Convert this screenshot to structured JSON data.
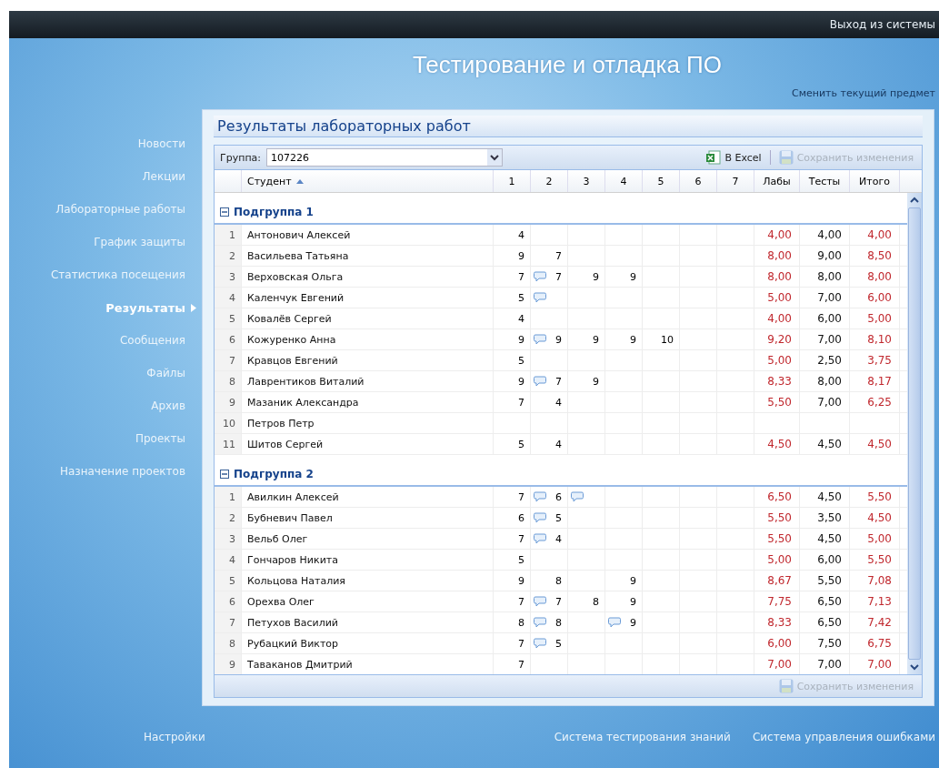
{
  "top_bar": {
    "logout_link": "Выход из системы"
  },
  "header": {
    "title": "Тестирование и отладка ПО",
    "change_subject_link": "Сменить текущий предмет"
  },
  "sidebar": {
    "items": [
      {
        "label": "Новости",
        "selected": false
      },
      {
        "label": "Лекции",
        "selected": false
      },
      {
        "label": "Лабораторные работы",
        "selected": false
      },
      {
        "label": "График защиты",
        "selected": false
      },
      {
        "label": "Статистика посещения",
        "selected": false
      },
      {
        "label": "Результаты",
        "selected": true
      },
      {
        "label": "Сообщения",
        "selected": false
      },
      {
        "label": "Файлы",
        "selected": false
      },
      {
        "label": "Архив",
        "selected": false
      },
      {
        "label": "Проекты",
        "selected": false
      },
      {
        "label": "Назначение проектов",
        "selected": false
      }
    ]
  },
  "panel": {
    "title": "Результаты лабораторных работ"
  },
  "toolbar": {
    "group_label": "Группа:",
    "group_value": "107226",
    "excel_button": "В Excel",
    "save_button": {
      "label": "Сохранить изменения",
      "disabled": true
    }
  },
  "grid": {
    "columns": [
      {
        "label": "Студент",
        "sorted_ascending": true
      },
      {
        "label": "1",
        "sorted_ascending": false
      },
      {
        "label": "2",
        "sorted_ascending": false
      },
      {
        "label": "3",
        "sorted_ascending": false
      },
      {
        "label": "4",
        "sorted_ascending": false
      },
      {
        "label": "5",
        "sorted_ascending": false
      },
      {
        "label": "6",
        "sorted_ascending": false
      },
      {
        "label": "7",
        "sorted_ascending": false
      },
      {
        "label": "Лабы",
        "sorted_ascending": false
      },
      {
        "label": "Тесты",
        "sorted_ascending": false
      },
      {
        "label": "Итого",
        "sorted_ascending": false
      }
    ],
    "groups": [
      {
        "title": "Подгруппа 1",
        "expanded": true,
        "rows": [
          {
            "number": "1",
            "name": "Антонович Алексей",
            "marks": [
              {
                "value": "4",
                "comment": false
              },
              {
                "comment": false
              },
              {
                "comment": false
              },
              {
                "comment": false
              },
              {
                "comment": false
              },
              {
                "comment": false
              },
              {
                "comment": false
              }
            ],
            "labs": "4,00",
            "tests": "4,00",
            "total": "4,00"
          },
          {
            "number": "2",
            "name": "Васильева Татьяна",
            "marks": [
              {
                "value": "9",
                "comment": false
              },
              {
                "value": "7",
                "comment": false
              },
              {
                "comment": false
              },
              {
                "comment": false
              },
              {
                "comment": false
              },
              {
                "comment": false
              },
              {
                "comment": false
              }
            ],
            "labs": "8,00",
            "tests": "9,00",
            "total": "8,50"
          },
          {
            "number": "3",
            "name": "Верховская Ольга",
            "marks": [
              {
                "value": "7",
                "comment": false
              },
              {
                "value": "7",
                "comment": true
              },
              {
                "value": "9",
                "comment": false
              },
              {
                "value": "9",
                "comment": false
              },
              {
                "comment": false
              },
              {
                "comment": false
              },
              {
                "comment": false
              }
            ],
            "labs": "8,00",
            "tests": "8,00",
            "total": "8,00"
          },
          {
            "number": "4",
            "name": "Каленчук Евгений",
            "marks": [
              {
                "value": "5",
                "comment": false
              },
              {
                "comment": true
              },
              {
                "comment": false
              },
              {
                "comment": false
              },
              {
                "comment": false
              },
              {
                "comment": false
              },
              {
                "comment": false
              }
            ],
            "labs": "5,00",
            "tests": "7,00",
            "total": "6,00"
          },
          {
            "number": "5",
            "name": "Ковалёв Сергей",
            "marks": [
              {
                "value": "4",
                "comment": false
              },
              {
                "comment": false
              },
              {
                "comment": false
              },
              {
                "comment": false
              },
              {
                "comment": false
              },
              {
                "comment": false
              },
              {
                "comment": false
              }
            ],
            "labs": "4,00",
            "tests": "6,00",
            "total": "5,00"
          },
          {
            "number": "6",
            "name": "Кожуренко Анна",
            "marks": [
              {
                "value": "9",
                "comment": false
              },
              {
                "value": "9",
                "comment": true
              },
              {
                "value": "9",
                "comment": false
              },
              {
                "value": "9",
                "comment": false
              },
              {
                "value": "10",
                "comment": false
              },
              {
                "comment": false
              },
              {
                "comment": false
              }
            ],
            "labs": "9,20",
            "tests": "7,00",
            "total": "8,10"
          },
          {
            "number": "7",
            "name": "Кравцов Евгений",
            "marks": [
              {
                "value": "5",
                "comment": false
              },
              {
                "comment": false
              },
              {
                "comment": false
              },
              {
                "comment": false
              },
              {
                "comment": false
              },
              {
                "comment": false
              },
              {
                "comment": false
              }
            ],
            "labs": "5,00",
            "tests": "2,50",
            "total": "3,75"
          },
          {
            "number": "8",
            "name": "Лаврентиков Виталий",
            "marks": [
              {
                "value": "9",
                "comment": false
              },
              {
                "value": "7",
                "comment": true
              },
              {
                "value": "9",
                "comment": false
              },
              {
                "comment": false
              },
              {
                "comment": false
              },
              {
                "comment": false
              },
              {
                "comment": false
              }
            ],
            "labs": "8,33",
            "tests": "8,00",
            "total": "8,17"
          },
          {
            "number": "9",
            "name": "Мазаник Александра",
            "marks": [
              {
                "value": "7",
                "comment": false
              },
              {
                "value": "4",
                "comment": false
              },
              {
                "comment": false
              },
              {
                "comment": false
              },
              {
                "comment": false
              },
              {
                "comment": false
              },
              {
                "comment": false
              }
            ],
            "labs": "5,50",
            "tests": "7,00",
            "total": "6,25"
          },
          {
            "number": "10",
            "name": "Петров Петр",
            "marks": [
              {
                "comment": false
              },
              {
                "comment": false
              },
              {
                "comment": false
              },
              {
                "comment": false
              },
              {
                "comment": false
              },
              {
                "comment": false
              },
              {
                "comment": false
              }
            ]
          },
          {
            "number": "11",
            "name": "Шитов Сергей",
            "marks": [
              {
                "value": "5",
                "comment": false
              },
              {
                "value": "4",
                "comment": false
              },
              {
                "comment": false
              },
              {
                "comment": false
              },
              {
                "comment": false
              },
              {
                "comment": false
              },
              {
                "comment": false
              }
            ],
            "labs": "4,50",
            "tests": "4,50",
            "total": "4,50"
          }
        ]
      },
      {
        "title": "Подгруппа 2",
        "expanded": true,
        "rows": [
          {
            "number": "1",
            "name": "Авилкин Алексей",
            "marks": [
              {
                "value": "7",
                "comment": false
              },
              {
                "value": "6",
                "comment": true
              },
              {
                "comment": true
              },
              {
                "comment": false
              },
              {
                "comment": false
              },
              {
                "comment": false
              },
              {
                "comment": false
              }
            ],
            "labs": "6,50",
            "tests": "4,50",
            "total": "5,50"
          },
          {
            "number": "2",
            "name": "Бубневич Павел",
            "marks": [
              {
                "value": "6",
                "comment": false
              },
              {
                "value": "5",
                "comment": true
              },
              {
                "comment": false
              },
              {
                "comment": false
              },
              {
                "comment": false
              },
              {
                "comment": false
              },
              {
                "comment": false
              }
            ],
            "labs": "5,50",
            "tests": "3,50",
            "total": "4,50"
          },
          {
            "number": "3",
            "name": "Вельб Олег",
            "marks": [
              {
                "value": "7",
                "comment": false
              },
              {
                "value": "4",
                "comment": true
              },
              {
                "comment": false
              },
              {
                "comment": false
              },
              {
                "comment": false
              },
              {
                "comment": false
              },
              {
                "comment": false
              }
            ],
            "labs": "5,50",
            "tests": "4,50",
            "total": "5,00"
          },
          {
            "number": "4",
            "name": "Гончаров Никита",
            "marks": [
              {
                "value": "5",
                "comment": false
              },
              {
                "comment": false
              },
              {
                "comment": false
              },
              {
                "comment": false
              },
              {
                "comment": false
              },
              {
                "comment": false
              },
              {
                "comment": false
              }
            ],
            "labs": "5,00",
            "tests": "6,00",
            "total": "5,50"
          },
          {
            "number": "5",
            "name": "Кольцова Наталия",
            "marks": [
              {
                "value": "9",
                "comment": false
              },
              {
                "value": "8",
                "comment": false
              },
              {
                "comment": false
              },
              {
                "value": "9",
                "comment": false
              },
              {
                "comment": false
              },
              {
                "comment": false
              },
              {
                "comment": false
              }
            ],
            "labs": "8,67",
            "tests": "5,50",
            "total": "7,08"
          },
          {
            "number": "6",
            "name": "Орехва Олег",
            "marks": [
              {
                "value": "7",
                "comment": false
              },
              {
                "value": "7",
                "comment": true
              },
              {
                "value": "8",
                "comment": false
              },
              {
                "value": "9",
                "comment": false
              },
              {
                "comment": false
              },
              {
                "comment": false
              },
              {
                "comment": false
              }
            ],
            "labs": "7,75",
            "tests": "6,50",
            "total": "7,13"
          },
          {
            "number": "7",
            "name": "Петухов Василий",
            "marks": [
              {
                "value": "8",
                "comment": false
              },
              {
                "value": "8",
                "comment": true
              },
              {
                "comment": false
              },
              {
                "value": "9",
                "comment": true
              },
              {
                "comment": false
              },
              {
                "comment": false
              },
              {
                "comment": false
              }
            ],
            "labs": "8,33",
            "tests": "6,50",
            "total": "7,42"
          },
          {
            "number": "8",
            "name": "Рубацкий Виктор",
            "marks": [
              {
                "value": "7",
                "comment": false
              },
              {
                "value": "5",
                "comment": true
              },
              {
                "comment": false
              },
              {
                "comment": false
              },
              {
                "comment": false
              },
              {
                "comment": false
              },
              {
                "comment": false
              }
            ],
            "labs": "6,00",
            "tests": "7,50",
            "total": "6,75"
          },
          {
            "number": "9",
            "name": "Таваканов Дмитрий",
            "marks": [
              {
                "value": "7",
                "comment": false
              },
              {
                "comment": false
              },
              {
                "comment": false
              },
              {
                "comment": false
              },
              {
                "comment": false
              },
              {
                "comment": false
              },
              {
                "comment": false
              }
            ],
            "labs": "7,00",
            "tests": "7,00",
            "total": "7,00"
          }
        ]
      }
    ]
  },
  "bottom_toolbar": {
    "save_button": {
      "label": "Сохранить изменения",
      "disabled": true
    }
  },
  "footer": {
    "links": [
      "Настройки",
      "Система тестирования знаний",
      "Система управления ошибками"
    ]
  }
}
